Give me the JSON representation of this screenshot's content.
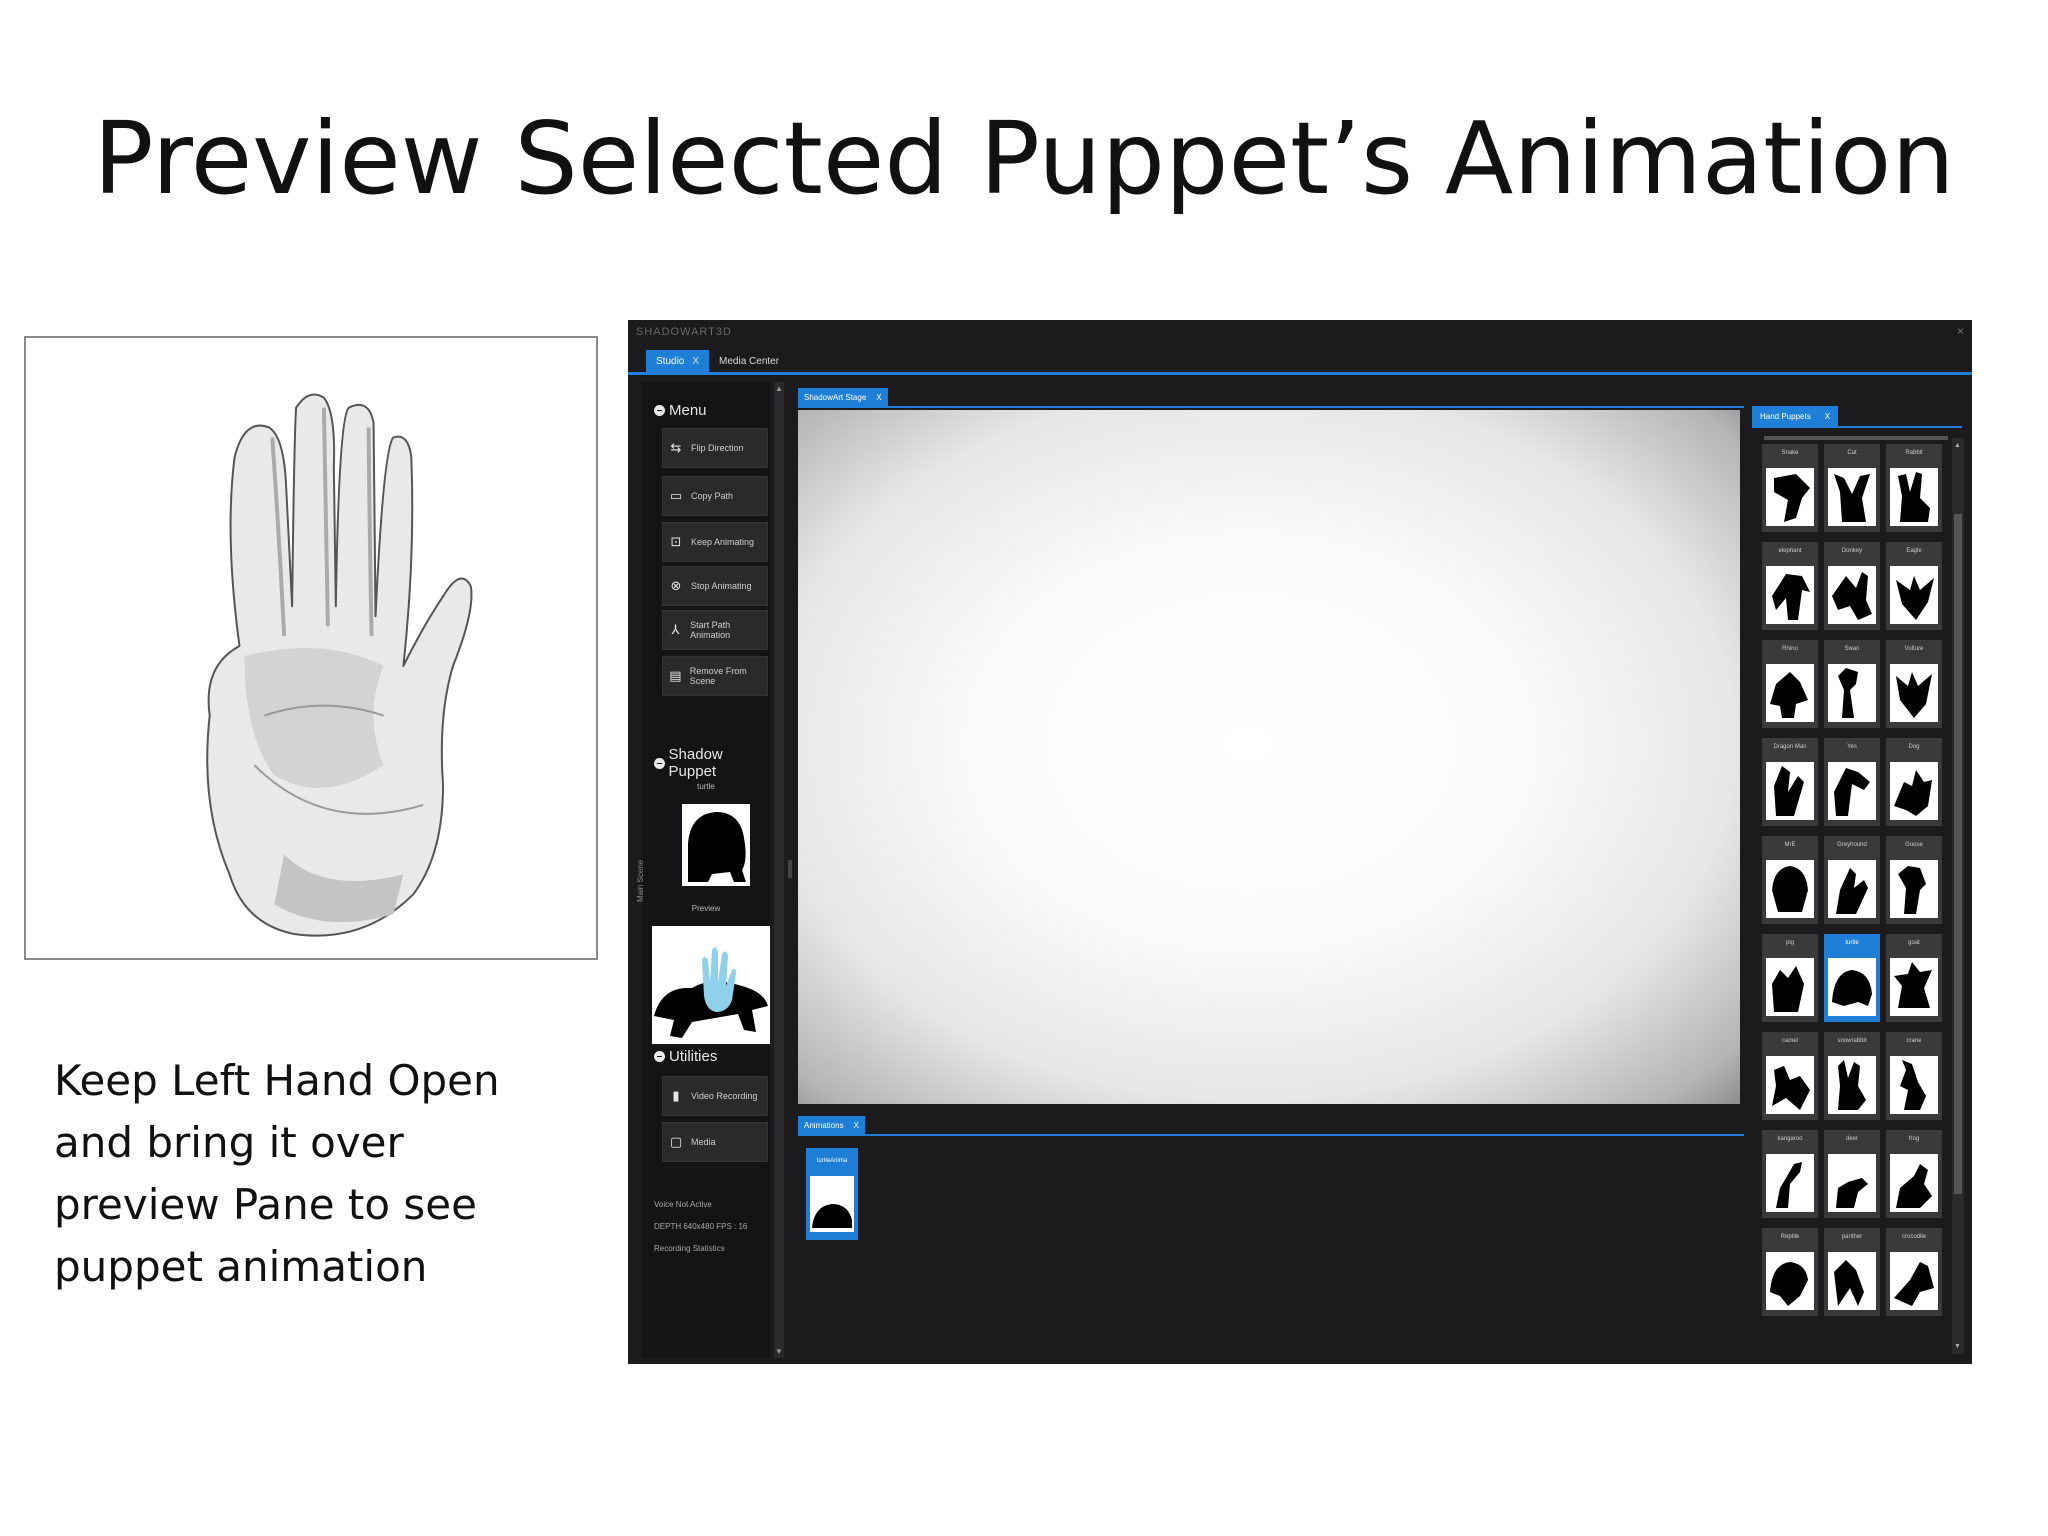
{
  "slide": {
    "title": "Preview Selected Puppet’s Animation",
    "caption_lines": [
      "Keep Left Hand Open",
      "and bring it over",
      "preview Pane to see",
      "puppet animation"
    ]
  },
  "app": {
    "title": "SHADOWART3D",
    "close_glyph": "×",
    "tabs": [
      {
        "label": "Studio",
        "close": "X"
      },
      {
        "label": "Media Center"
      }
    ],
    "menu": {
      "heading": "Menu",
      "items": [
        {
          "label": "Flip Direction",
          "icon": "flip-icon"
        },
        {
          "label": "Copy Path",
          "icon": "book-icon"
        },
        {
          "label": "Keep Animating",
          "icon": "repeat-icon"
        },
        {
          "label": "Stop Animating",
          "icon": "stop-icon"
        },
        {
          "label": "Start Path Animation",
          "icon": "path-icon"
        },
        {
          "label": "Remove From Scene",
          "icon": "trash-icon"
        }
      ]
    },
    "shadow_puppet": {
      "heading": "Shadow Puppet",
      "name": "turtle",
      "preview_label": "Preview"
    },
    "utilities": {
      "heading": "Utilities",
      "items": [
        {
          "label": "Video Recording",
          "icon": "camera-icon"
        },
        {
          "label": "Media",
          "icon": "monitor-icon"
        }
      ]
    },
    "status": [
      "Voice Not Active",
      "DEPTH 640x480 FPS : 16",
      "Recording Statistics"
    ],
    "vertical_label": "Main Scene",
    "stage_tab": {
      "label": "ShadowArt Stage",
      "close": "X"
    },
    "animations_tab": {
      "label": "Animations",
      "close": "X"
    },
    "animation_item": {
      "label": "turtleAnima"
    },
    "hand_puppets_tab": {
      "label": "Hand Puppets",
      "close": "X"
    },
    "hand_puppets": [
      "Snake",
      "Cat",
      "Rabbit",
      "elephant",
      "Donkey",
      "Eagle",
      "Rhino",
      "Swan",
      "Vulture",
      "Dragon Man",
      "Yes",
      "Dog",
      "MrE",
      "Greyhound",
      "Goose",
      "pig",
      "turtle",
      "goat",
      "camel",
      "snowrabbit",
      "crane",
      "kangaroo",
      "deer",
      "frog",
      "Reptile",
      "panther",
      "crocodile"
    ],
    "selected_puppet": "turtle",
    "accent_color": "#1f7fd6"
  }
}
